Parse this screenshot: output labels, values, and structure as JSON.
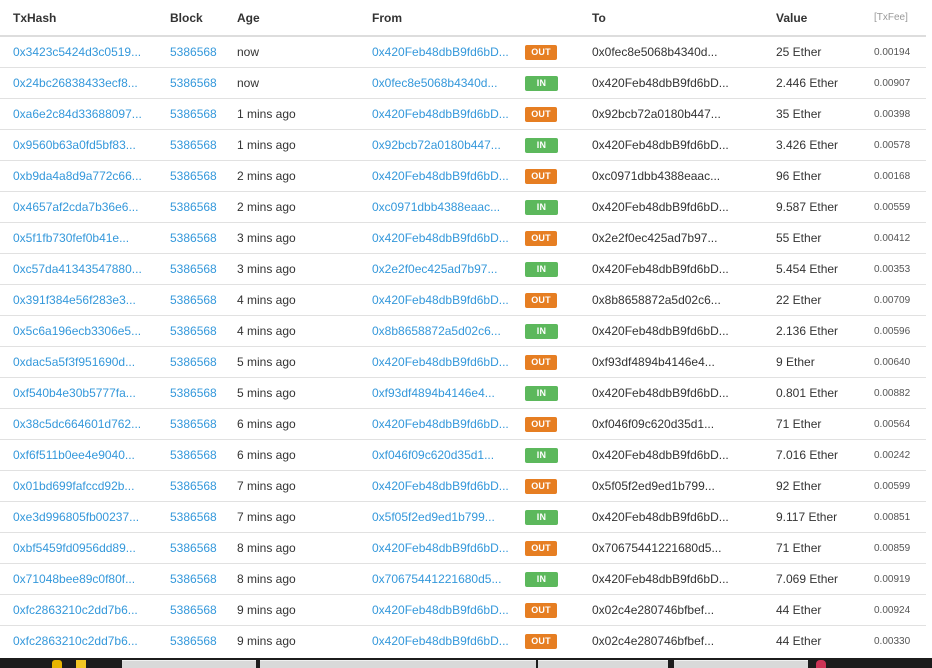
{
  "headers": [
    "TxHash",
    "Block",
    "Age",
    "From",
    "To",
    "Value",
    "[TxFee]"
  ],
  "rows": [
    {
      "txhash": "0x3423c5424d3c0519...",
      "block": "5386568",
      "age": "now",
      "from": "0x420Feb48dbB9fd6bD...",
      "dir": "OUT",
      "to": "0x0fec8e5068b4340d...",
      "value": "25 Ether",
      "fee": "0.00194"
    },
    {
      "txhash": "0x24bc26838433ecf8...",
      "block": "5386568",
      "age": "now",
      "from": "0x0fec8e5068b4340d...",
      "dir": "IN",
      "to": "0x420Feb48dbB9fd6bD...",
      "value": "2.446 Ether",
      "fee": "0.00907"
    },
    {
      "txhash": "0xa6e2c84d33688097...",
      "block": "5386568",
      "age": "1 mins ago",
      "from": "0x420Feb48dbB9fd6bD...",
      "dir": "OUT",
      "to": "0x92bcb72a0180b447...",
      "value": "35 Ether",
      "fee": "0.00398"
    },
    {
      "txhash": "0x9560b63a0fd5bf83...",
      "block": "5386568",
      "age": "1 mins ago",
      "from": "0x92bcb72a0180b447...",
      "dir": "IN",
      "to": "0x420Feb48dbB9fd6bD...",
      "value": "3.426 Ether",
      "fee": "0.00578"
    },
    {
      "txhash": "0xb9da4a8d9a772c66...",
      "block": "5386568",
      "age": "2 mins ago",
      "from": "0x420Feb48dbB9fd6bD...",
      "dir": "OUT",
      "to": "0xc0971dbb4388eaac...",
      "value": "96 Ether",
      "fee": "0.00168"
    },
    {
      "txhash": "0x4657af2cda7b36e6...",
      "block": "5386568",
      "age": "2 mins ago",
      "from": "0xc0971dbb4388eaac...",
      "dir": "IN",
      "to": "0x420Feb48dbB9fd6bD...",
      "value": "9.587 Ether",
      "fee": "0.00559"
    },
    {
      "txhash": "0x5f1fb730fef0b41e...",
      "block": "5386568",
      "age": "3 mins ago",
      "from": "0x420Feb48dbB9fd6bD...",
      "dir": "OUT",
      "to": "0x2e2f0ec425ad7b97...",
      "value": "55 Ether",
      "fee": "0.00412"
    },
    {
      "txhash": "0xc57da41343547880...",
      "block": "5386568",
      "age": "3 mins ago",
      "from": "0x2e2f0ec425ad7b97...",
      "dir": "IN",
      "to": "0x420Feb48dbB9fd6bD...",
      "value": "5.454 Ether",
      "fee": "0.00353"
    },
    {
      "txhash": "0x391f384e56f283e3...",
      "block": "5386568",
      "age": "4 mins ago",
      "from": "0x420Feb48dbB9fd6bD...",
      "dir": "OUT",
      "to": "0x8b8658872a5d02c6...",
      "value": "22 Ether",
      "fee": "0.00709"
    },
    {
      "txhash": "0x5c6a196ecb3306e5...",
      "block": "5386568",
      "age": "4 mins ago",
      "from": "0x8b8658872a5d02c6...",
      "dir": "IN",
      "to": "0x420Feb48dbB9fd6bD...",
      "value": "2.136 Ether",
      "fee": "0.00596"
    },
    {
      "txhash": "0xdac5a5f3f951690d...",
      "block": "5386568",
      "age": "5 mins ago",
      "from": "0x420Feb48dbB9fd6bD...",
      "dir": "OUT",
      "to": "0xf93df4894b4146e4...",
      "value": "9 Ether",
      "fee": "0.00640"
    },
    {
      "txhash": "0xf540b4e30b5777fa...",
      "block": "5386568",
      "age": "5 mins ago",
      "from": "0xf93df4894b4146e4...",
      "dir": "IN",
      "to": "0x420Feb48dbB9fd6bD...",
      "value": "0.801 Ether",
      "fee": "0.00882"
    },
    {
      "txhash": "0x38c5dc664601d762...",
      "block": "5386568",
      "age": "6 mins ago",
      "from": "0x420Feb48dbB9fd6bD...",
      "dir": "OUT",
      "to": "0xf046f09c620d35d1...",
      "value": "71 Ether",
      "fee": "0.00564"
    },
    {
      "txhash": "0xf6f511b0ee4e9040...",
      "block": "5386568",
      "age": "6 mins ago",
      "from": "0xf046f09c620d35d1...",
      "dir": "IN",
      "to": "0x420Feb48dbB9fd6bD...",
      "value": "7.016 Ether",
      "fee": "0.00242"
    },
    {
      "txhash": "0x01bd699fafccd92b...",
      "block": "5386568",
      "age": "7 mins ago",
      "from": "0x420Feb48dbB9fd6bD...",
      "dir": "OUT",
      "to": "0x5f05f2ed9ed1b799...",
      "value": "92 Ether",
      "fee": "0.00599"
    },
    {
      "txhash": "0xe3d996805fb00237...",
      "block": "5386568",
      "age": "7 mins ago",
      "from": "0x5f05f2ed9ed1b799...",
      "dir": "IN",
      "to": "0x420Feb48dbB9fd6bD...",
      "value": "9.117 Ether",
      "fee": "0.00851"
    },
    {
      "txhash": "0xbf5459fd0956dd89...",
      "block": "5386568",
      "age": "8 mins ago",
      "from": "0x420Feb48dbB9fd6bD...",
      "dir": "OUT",
      "to": "0x70675441221680d5...",
      "value": "71 Ether",
      "fee": "0.00859"
    },
    {
      "txhash": "0x71048bee89c0f80f...",
      "block": "5386568",
      "age": "8 mins ago",
      "from": "0x70675441221680d5...",
      "dir": "IN",
      "to": "0x420Feb48dbB9fd6bD...",
      "value": "7.069 Ether",
      "fee": "0.00919"
    },
    {
      "txhash": "0xfc2863210c2dd7b6...",
      "block": "5386568",
      "age": "9 mins ago",
      "from": "0x420Feb48dbB9fd6bD...",
      "dir": "OUT",
      "to": "0x02c4e280746bfbef...",
      "value": "44 Ether",
      "fee": "0.00924"
    },
    {
      "txhash": "0xfc2863210c2dd7b6...",
      "block": "5386568",
      "age": "9 mins ago",
      "from": "0x420Feb48dbB9fd6bD...",
      "dir": "OUT",
      "to": "0x02c4e280746bfbef...",
      "value": "44 Ether",
      "fee": "0.00330"
    }
  ],
  "colors": {
    "link": "#3498db",
    "out_badge": "#e67e22",
    "in_badge": "#5cb85c"
  }
}
